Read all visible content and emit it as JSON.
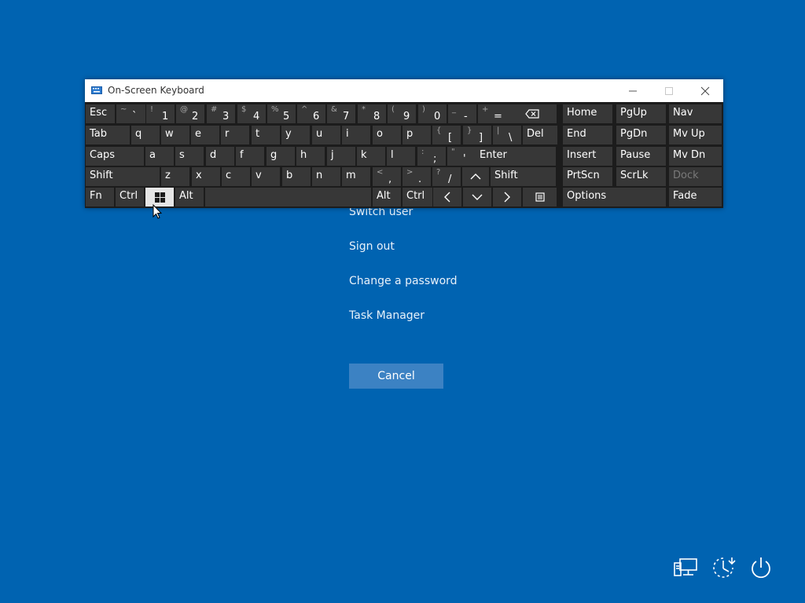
{
  "menu": {
    "switch_user": "Switch user",
    "sign_out": "Sign out",
    "change_password": "Change a password",
    "task_manager": "Task Manager",
    "cancel": "Cancel"
  },
  "osk": {
    "title": "On-Screen Keyboard",
    "row1": [
      {
        "t": "Esc"
      },
      {
        "s": "~",
        "p": "`"
      },
      {
        "s": "!",
        "p": "1"
      },
      {
        "s": "@",
        "p": "2"
      },
      {
        "s": "#",
        "p": "3"
      },
      {
        "s": "$",
        "p": "4"
      },
      {
        "s": "%",
        "p": "5"
      },
      {
        "s": "^",
        "p": "6"
      },
      {
        "s": "&",
        "p": "7"
      },
      {
        "s": "*",
        "p": "8"
      },
      {
        "s": "(",
        "p": "9"
      },
      {
        "s": ")",
        "p": "0"
      },
      {
        "s": "_",
        "p": "-"
      },
      {
        "s": "+",
        "p": "="
      },
      {
        "icon": "backspace-icon"
      },
      {
        "t": "Home"
      },
      {
        "t": "PgUp"
      },
      {
        "t": "Nav"
      }
    ],
    "row2": [
      {
        "t": "Tab"
      },
      {
        "t": "q"
      },
      {
        "t": "w"
      },
      {
        "t": "e"
      },
      {
        "t": "r"
      },
      {
        "t": "t"
      },
      {
        "t": "y"
      },
      {
        "t": "u"
      },
      {
        "t": "i"
      },
      {
        "t": "o"
      },
      {
        "t": "p"
      },
      {
        "s": "{",
        "p": "["
      },
      {
        "s": "}",
        "p": "]"
      },
      {
        "s": "|",
        "p": "\\"
      },
      {
        "t": "Del"
      },
      {
        "t": "End"
      },
      {
        "t": "PgDn"
      },
      {
        "t": "Mv Up"
      }
    ],
    "row3": [
      {
        "t": "Caps"
      },
      {
        "t": "a"
      },
      {
        "t": "s"
      },
      {
        "t": "d"
      },
      {
        "t": "f"
      },
      {
        "t": "g"
      },
      {
        "t": "h"
      },
      {
        "t": "j"
      },
      {
        "t": "k"
      },
      {
        "t": "l"
      },
      {
        "s": ":",
        "p": ";"
      },
      {
        "s": "\"",
        "p": "'"
      },
      {
        "t": "Enter"
      },
      {
        "t": "Insert"
      },
      {
        "t": "Pause"
      },
      {
        "t": "Mv Dn"
      }
    ],
    "row4": [
      {
        "t": "Shift"
      },
      {
        "t": "z"
      },
      {
        "t": "x"
      },
      {
        "t": "c"
      },
      {
        "t": "v"
      },
      {
        "t": "b"
      },
      {
        "t": "n"
      },
      {
        "t": "m"
      },
      {
        "s": "<",
        "p": ","
      },
      {
        "s": ">",
        "p": "."
      },
      {
        "s": "?",
        "p": "/"
      },
      {
        "icon": "arrow-up-icon"
      },
      {
        "t": "Shift"
      },
      {
        "t": "PrtScn"
      },
      {
        "t": "ScrLk"
      },
      {
        "t": "Dock",
        "disabled": true
      }
    ],
    "row5": [
      {
        "t": "Fn"
      },
      {
        "t": "Ctrl"
      },
      {
        "icon": "windows-logo-icon",
        "active": true
      },
      {
        "t": "Alt"
      },
      {
        "t": ""
      },
      {
        "t": "Alt"
      },
      {
        "t": "Ctrl"
      },
      {
        "icon": "arrow-left-icon"
      },
      {
        "icon": "arrow-down-icon"
      },
      {
        "icon": "arrow-right-icon"
      },
      {
        "icon": "menu-key-icon"
      },
      {
        "t": "Options"
      },
      {
        "t": "Fade"
      }
    ]
  },
  "system_icons": [
    "network-icon",
    "ease-of-access-icon",
    "power-icon"
  ]
}
